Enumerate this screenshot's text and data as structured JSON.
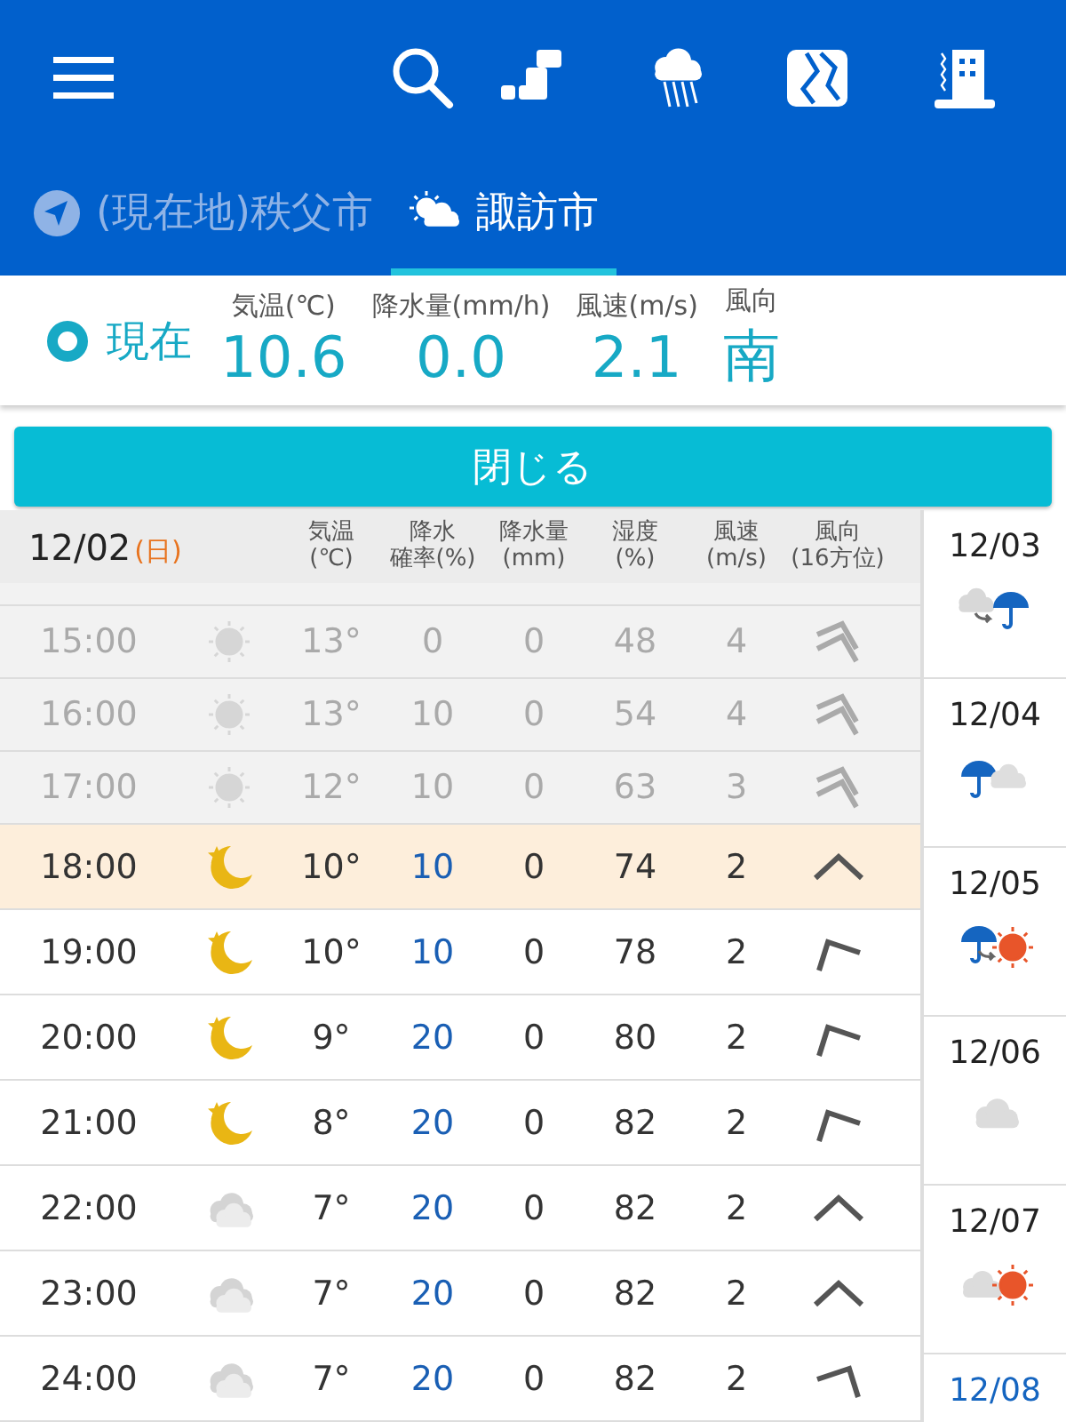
{
  "tabs": [
    {
      "label": "(現在地)秩父市",
      "kind": "location",
      "selected": false
    },
    {
      "label": "諏訪市",
      "kind": "weather",
      "selected": true
    }
  ],
  "current": {
    "label": "現在",
    "readings": [
      {
        "label": "気温(℃)",
        "value": "10.6"
      },
      {
        "label": "降水量(mm/h)",
        "value": "0.0"
      },
      {
        "label": "風速(m/s)",
        "value": "2.1"
      },
      {
        "label": "風向",
        "value": "南"
      }
    ]
  },
  "close_button": "閉じる",
  "table": {
    "date": "12/02",
    "weekday": {
      "text": "(日)",
      "color": "#e8731e"
    },
    "columns": [
      {
        "lines": [
          "気温",
          "(℃)"
        ]
      },
      {
        "lines": [
          "降水",
          "確率(%)"
        ]
      },
      {
        "lines": [
          "降水量",
          "(mm)"
        ]
      },
      {
        "lines": [
          "湿度",
          "(%)"
        ]
      },
      {
        "lines": [
          "風速",
          "(m/s)"
        ]
      },
      {
        "lines": [
          "風向",
          "(16方位)"
        ]
      }
    ],
    "rows": [
      {
        "time": "15:00",
        "weather": {
          "kind": "sun"
        },
        "temp": "13°",
        "prob": "0",
        "amount": "0",
        "humidity": "48",
        "wind_speed": "4",
        "wind": {
          "kind": "double"
        },
        "past": true,
        "current": false
      },
      {
        "time": "16:00",
        "weather": {
          "kind": "sun"
        },
        "temp": "13°",
        "prob": "10",
        "amount": "0",
        "humidity": "54",
        "wind_speed": "4",
        "wind": {
          "kind": "double"
        },
        "past": true,
        "current": false
      },
      {
        "time": "17:00",
        "weather": {
          "kind": "sun"
        },
        "temp": "12°",
        "prob": "10",
        "amount": "0",
        "humidity": "63",
        "wind_speed": "3",
        "wind": {
          "kind": "double"
        },
        "past": true,
        "current": false
      },
      {
        "time": "18:00",
        "weather": {
          "kind": "moon"
        },
        "temp": "10°",
        "prob": "10",
        "amount": "0",
        "humidity": "74",
        "wind_speed": "2",
        "wind": {
          "kind": "up"
        },
        "past": false,
        "current": true
      },
      {
        "time": "19:00",
        "weather": {
          "kind": "moon"
        },
        "temp": "10°",
        "prob": "10",
        "amount": "0",
        "humidity": "78",
        "wind_speed": "2",
        "wind": {
          "kind": "tilted"
        },
        "past": false,
        "current": false
      },
      {
        "time": "20:00",
        "weather": {
          "kind": "moon"
        },
        "temp": "9°",
        "prob": "20",
        "amount": "0",
        "humidity": "80",
        "wind_speed": "2",
        "wind": {
          "kind": "tilted"
        },
        "past": false,
        "current": false
      },
      {
        "time": "21:00",
        "weather": {
          "kind": "moon"
        },
        "temp": "8°",
        "prob": "20",
        "amount": "0",
        "humidity": "82",
        "wind_speed": "2",
        "wind": {
          "kind": "tilted"
        },
        "past": false,
        "current": false
      },
      {
        "time": "22:00",
        "weather": {
          "kind": "cloud"
        },
        "temp": "7°",
        "prob": "20",
        "amount": "0",
        "humidity": "82",
        "wind_speed": "2",
        "wind": {
          "kind": "up"
        },
        "past": false,
        "current": false
      },
      {
        "time": "23:00",
        "weather": {
          "kind": "cloud"
        },
        "temp": "7°",
        "prob": "20",
        "amount": "0",
        "humidity": "82",
        "wind_speed": "2",
        "wind": {
          "kind": "up"
        },
        "past": false,
        "current": false
      },
      {
        "time": "24:00",
        "weather": {
          "kind": "cloud"
        },
        "temp": "7°",
        "prob": "20",
        "amount": "0",
        "humidity": "82",
        "wind_speed": "2",
        "wind": {
          "kind": "tilted-right"
        },
        "past": false,
        "current": false
      }
    ]
  },
  "days": [
    {
      "date": "12/03",
      "forecast": {
        "kind": "cloud-then-rain"
      },
      "color": "#222222"
    },
    {
      "date": "12/04",
      "forecast": {
        "kind": "rain-cloud"
      },
      "color": "#222222"
    },
    {
      "date": "12/05",
      "forecast": {
        "kind": "rain-then-sun"
      },
      "color": "#222222"
    },
    {
      "date": "12/06",
      "forecast": {
        "kind": "cloud"
      },
      "color": "#222222"
    },
    {
      "date": "12/07",
      "forecast": {
        "kind": "cloud-sun"
      },
      "color": "#222222"
    },
    {
      "date": "12/08",
      "color": "#1565c0"
    }
  ]
}
